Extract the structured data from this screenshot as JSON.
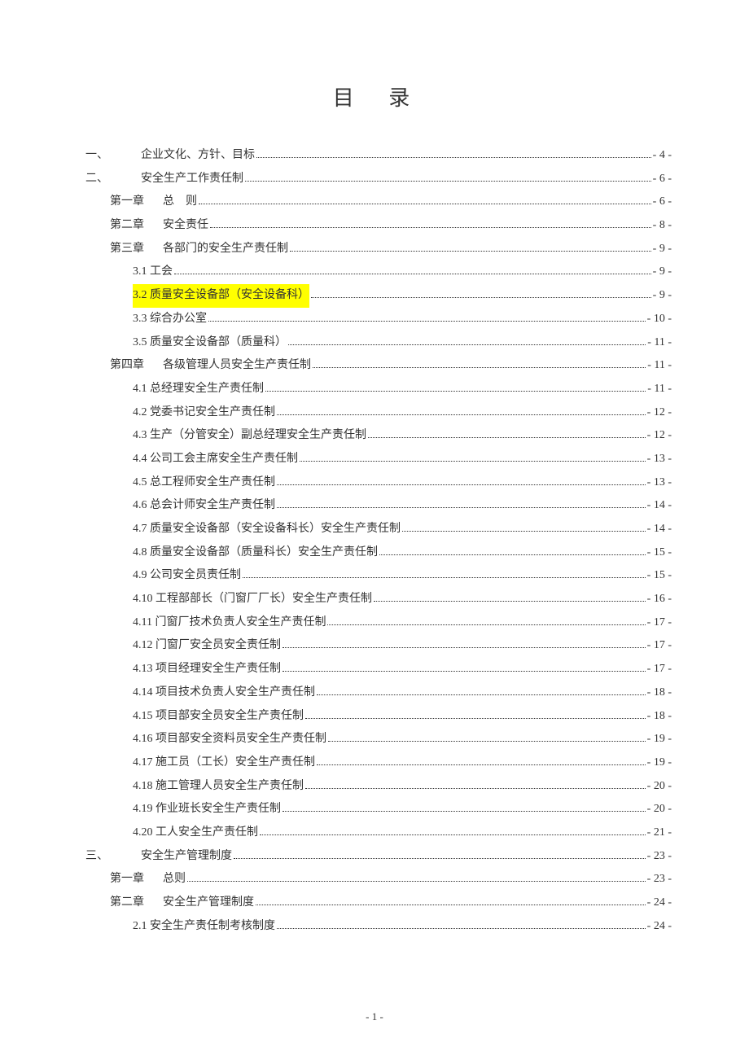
{
  "title": "目 录",
  "page_number": "- 1 -",
  "toc": [
    {
      "indent": 0,
      "prefix": "一、",
      "label": "企业文化、方针、目标",
      "page": "- 4 -",
      "highlight": false,
      "prefixClass": "num-col"
    },
    {
      "indent": 0,
      "prefix": "二、",
      "label": "安全生产工作责任制",
      "page": "- 6 -",
      "highlight": false,
      "prefixClass": "num-col"
    },
    {
      "indent": 1,
      "prefix": "第一章",
      "label": "总　则",
      "page": "- 6 -",
      "highlight": false,
      "prefixClass": "num-col-narrow",
      "chapGap": true
    },
    {
      "indent": 1,
      "prefix": "第二章",
      "label": "安全责任",
      "page": "- 8 -",
      "highlight": false,
      "prefixClass": "num-col-narrow",
      "chapGap": true
    },
    {
      "indent": 1,
      "prefix": "第三章",
      "label": "各部门的安全生产责任制",
      "page": "- 9 -",
      "highlight": false,
      "prefixClass": "num-col-narrow",
      "chapGap": true
    },
    {
      "indent": 2,
      "prefix": "",
      "label": "3.1 工会",
      "page": "- 9 -",
      "highlight": false
    },
    {
      "indent": 2,
      "prefix": "",
      "label": "3.2 质量安全设备部（安全设备科）",
      "page": "- 9 -",
      "highlight": true
    },
    {
      "indent": 2,
      "prefix": "",
      "label": "3.3 综合办公室",
      "page": "- 10 -",
      "highlight": false
    },
    {
      "indent": 2,
      "prefix": "",
      "label": "3.5 质量安全设备部（质量科）",
      "page": "- 11 -",
      "highlight": false
    },
    {
      "indent": 1,
      "prefix": "第四章",
      "label": "各级管理人员安全生产责任制",
      "page": "- 11 -",
      "highlight": false,
      "prefixClass": "num-col-narrow",
      "chapGap": true
    },
    {
      "indent": 2,
      "prefix": "",
      "label": "4.1 总经理安全生产责任制",
      "page": "- 11 -",
      "highlight": false
    },
    {
      "indent": 2,
      "prefix": "",
      "label": "4.2 党委书记安全生产责任制",
      "page": "- 12 -",
      "highlight": false
    },
    {
      "indent": 2,
      "prefix": "",
      "label": "4.3 生产（分管安全）副总经理安全生产责任制",
      "page": "- 12 -",
      "highlight": false
    },
    {
      "indent": 2,
      "prefix": "",
      "label": "4.4 公司工会主席安全生产责任制",
      "page": "- 13 -",
      "highlight": false
    },
    {
      "indent": 2,
      "prefix": "",
      "label": "4.5 总工程师安全生产责任制",
      "page": "- 13 -",
      "highlight": false
    },
    {
      "indent": 2,
      "prefix": "",
      "label": "4.6 总会计师安全生产责任制",
      "page": "- 14 -",
      "highlight": false
    },
    {
      "indent": 2,
      "prefix": "",
      "label": "4.7 质量安全设备部（安全设备科长）安全生产责任制",
      "page": "- 14 -",
      "highlight": false
    },
    {
      "indent": 2,
      "prefix": "",
      "label": "4.8 质量安全设备部（质量科长）安全生产责任制",
      "page": "- 15 -",
      "highlight": false
    },
    {
      "indent": 2,
      "prefix": "",
      "label": "4.9 公司安全员责任制",
      "page": "- 15 -",
      "highlight": false
    },
    {
      "indent": 2,
      "prefix": "",
      "label": "4.10 工程部部长（门窗厂厂长）安全生产责任制",
      "page": "- 16 -",
      "highlight": false
    },
    {
      "indent": 2,
      "prefix": "",
      "label": "4.11 门窗厂技术负责人安全生产责任制",
      "page": "- 17 -",
      "highlight": false
    },
    {
      "indent": 2,
      "prefix": "",
      "label": "4.12 门窗厂安全员安全责任制",
      "page": "- 17 -",
      "highlight": false
    },
    {
      "indent": 2,
      "prefix": "",
      "label": "4.13 项目经理安全生产责任制",
      "page": "- 17 -",
      "highlight": false
    },
    {
      "indent": 2,
      "prefix": "",
      "label": "4.14 项目技术负责人安全生产责任制",
      "page": "- 18 -",
      "highlight": false
    },
    {
      "indent": 2,
      "prefix": "",
      "label": "4.15 项目部安全员安全生产责任制",
      "page": "- 18 -",
      "highlight": false
    },
    {
      "indent": 2,
      "prefix": "",
      "label": "4.16 项目部安全资料员安全生产责任制",
      "page": "- 19 -",
      "highlight": false
    },
    {
      "indent": 2,
      "prefix": "",
      "label": "4.17 施工员（工长）安全生产责任制",
      "page": "- 19 -",
      "highlight": false
    },
    {
      "indent": 2,
      "prefix": "",
      "label": "4.18 施工管理人员安全生产责任制",
      "page": "- 20 -",
      "highlight": false
    },
    {
      "indent": 2,
      "prefix": "",
      "label": "4.19 作业班长安全生产责任制",
      "page": "- 20 -",
      "highlight": false
    },
    {
      "indent": 2,
      "prefix": "",
      "label": "4.20 工人安全生产责任制",
      "page": "- 21 -",
      "highlight": false
    },
    {
      "indent": 0,
      "prefix": "三、",
      "label": "安全生产管理制度",
      "page": "- 23 -",
      "highlight": false,
      "prefixClass": "num-col"
    },
    {
      "indent": 1,
      "prefix": "第一章",
      "label": "总则",
      "page": "- 23 -",
      "highlight": false,
      "prefixClass": "num-col-narrow",
      "chapGap": true
    },
    {
      "indent": 1,
      "prefix": "第二章",
      "label": "安全生产管理制度",
      "page": "- 24 -",
      "highlight": false,
      "prefixClass": "num-col-narrow",
      "chapGap": true
    },
    {
      "indent": 2,
      "prefix": "",
      "label": "2.1 安全生产责任制考核制度",
      "page": "- 24 -",
      "highlight": false
    }
  ]
}
